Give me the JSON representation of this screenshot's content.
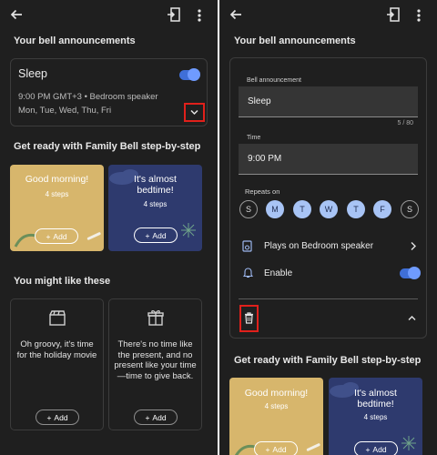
{
  "header": {
    "back_icon": "back-arrow-icon",
    "cast_icon": "cast-icon",
    "more_icon": "more-vert-icon"
  },
  "left": {
    "announcements_title": "Your bell announcements",
    "alarm": {
      "name": "Sleep",
      "enabled": true,
      "time_speaker": "9:00 PM GMT+3 • Bedroom speaker",
      "days": "Mon, Tue, Wed, Thu, Fri"
    },
    "family_bell_title": "Get ready with Family Bell step-by-step",
    "routines": [
      {
        "title": "Good morning!",
        "steps": "4 steps",
        "add": "Add"
      },
      {
        "title": "It's almost bedtime!",
        "steps": "4 steps",
        "add": "Add"
      }
    ],
    "might_like_title": "You might like these",
    "ideas": [
      {
        "text": "Oh groovy, it's time for the holiday movie",
        "icon": "clapperboard-icon",
        "add": "Add"
      },
      {
        "text": "There's no time like the present, and no present like your time—time to give back.",
        "icon": "gift-icon",
        "add": "Add"
      }
    ]
  },
  "right": {
    "announcements_title": "Your bell announcements",
    "bell_label": "Bell announcement",
    "bell_value": "Sleep",
    "counter": "5 / 80",
    "time_label": "Time",
    "time_value": "9:00 PM",
    "repeats_label": "Repeats on",
    "days": [
      {
        "letter": "S",
        "on": false
      },
      {
        "letter": "M",
        "on": true
      },
      {
        "letter": "T",
        "on": true
      },
      {
        "letter": "W",
        "on": true
      },
      {
        "letter": "T",
        "on": true
      },
      {
        "letter": "F",
        "on": true
      },
      {
        "letter": "S",
        "on": false
      }
    ],
    "speaker_row": "Plays on Bedroom speaker",
    "enable_row": "Enable",
    "family_bell_title": "Get ready with Family Bell step-by-step",
    "routines": [
      {
        "title": "Good morning!",
        "steps": "4 steps",
        "add": "Add"
      },
      {
        "title": "It's almost bedtime!",
        "steps": "4 steps",
        "add": "Add"
      }
    ]
  },
  "colors": {
    "background": "#1f1f1f",
    "accent": "#3f6fd8",
    "highlight": "#e0201b",
    "gold_card": "#d7b66c",
    "navy_card": "#2e3a6e"
  }
}
